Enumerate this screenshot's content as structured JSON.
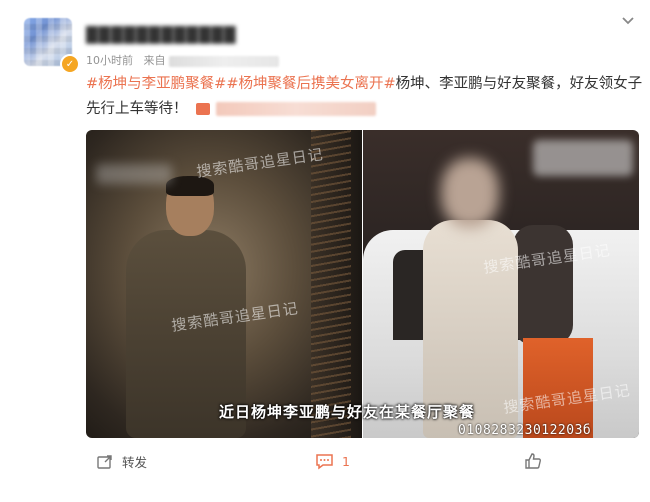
{
  "post": {
    "meta": {
      "time": "10小时前",
      "source_prefix": "来自"
    },
    "text": {
      "tag1": "#杨坤与李亚鹏聚餐#",
      "tag2": "#杨坤聚餐后携美女离开#",
      "body": "杨坤、李亚鹏与好友聚餐，好友领女子先行上车等待！"
    },
    "media": {
      "watermark": "搜索酷哥追星日记",
      "caption": "近日杨坤李亚鹏与好友在某餐厅聚餐",
      "code": "010828323012203б"
    },
    "actions": {
      "repost_label": "转发",
      "comment_count": "1",
      "like_label": ""
    }
  },
  "colors": {
    "accent": "#eb7350",
    "text": "#333333",
    "meta": "#939393"
  },
  "icons": [
    "chevron-down-icon",
    "verified-icon",
    "repost-icon",
    "comment-icon",
    "like-icon"
  ]
}
